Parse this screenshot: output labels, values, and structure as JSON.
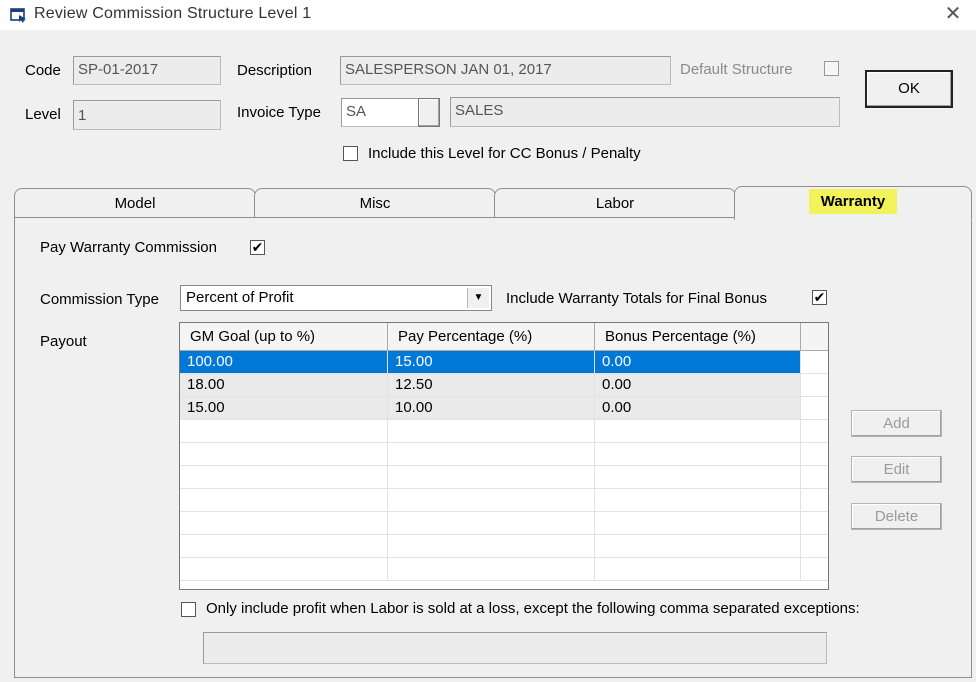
{
  "window": {
    "title": "Review Commission Structure Level  1"
  },
  "header": {
    "code_label": "Code",
    "code_value": "SP-01-2017",
    "description_label": "Description",
    "description_value": "SALESPERSON JAN 01, 2017",
    "default_structure_label": "Default Structure",
    "default_structure_checked": false,
    "level_label": "Level",
    "level_value": "1",
    "invoice_type_label": "Invoice Type",
    "invoice_type_code": "SA",
    "invoice_type_name": "SALES",
    "include_cc_label": "Include this Level for CC Bonus / Penalty",
    "include_cc_checked": false,
    "ok_label": "OK"
  },
  "tabs": [
    {
      "label": "Model",
      "active": false
    },
    {
      "label": "Misc",
      "active": false
    },
    {
      "label": "Labor",
      "active": false
    },
    {
      "label": "Warranty",
      "active": true
    }
  ],
  "warranty": {
    "pay_commission_label": "Pay Warranty Commission",
    "pay_commission_checked": true,
    "commission_type_label": "Commission Type",
    "commission_type_value": "Percent of Profit",
    "include_totals_label": "Include Warranty Totals for Final Bonus",
    "include_totals_checked": true,
    "payout_label": "Payout",
    "columns": [
      "GM Goal (up to %)",
      "Pay Percentage (%)",
      "Bonus Percentage (%)"
    ],
    "rows": [
      [
        "100.00",
        "15.00",
        "0.00"
      ],
      [
        "18.00",
        "12.50",
        "0.00"
      ],
      [
        "15.00",
        "10.00",
        "0.00"
      ]
    ],
    "selected_row": 0,
    "add_label": "Add",
    "edit_label": "Edit",
    "delete_label": "Delete",
    "labor_loss_label": "Only include profit when Labor is sold at a loss, except the following comma separated exceptions:",
    "labor_loss_checked": false,
    "exceptions_value": ""
  },
  "colors": {
    "selection": "#0078d7",
    "tab_highlight": "#f2f25a",
    "dialog_bg": "#f0f0f0"
  }
}
